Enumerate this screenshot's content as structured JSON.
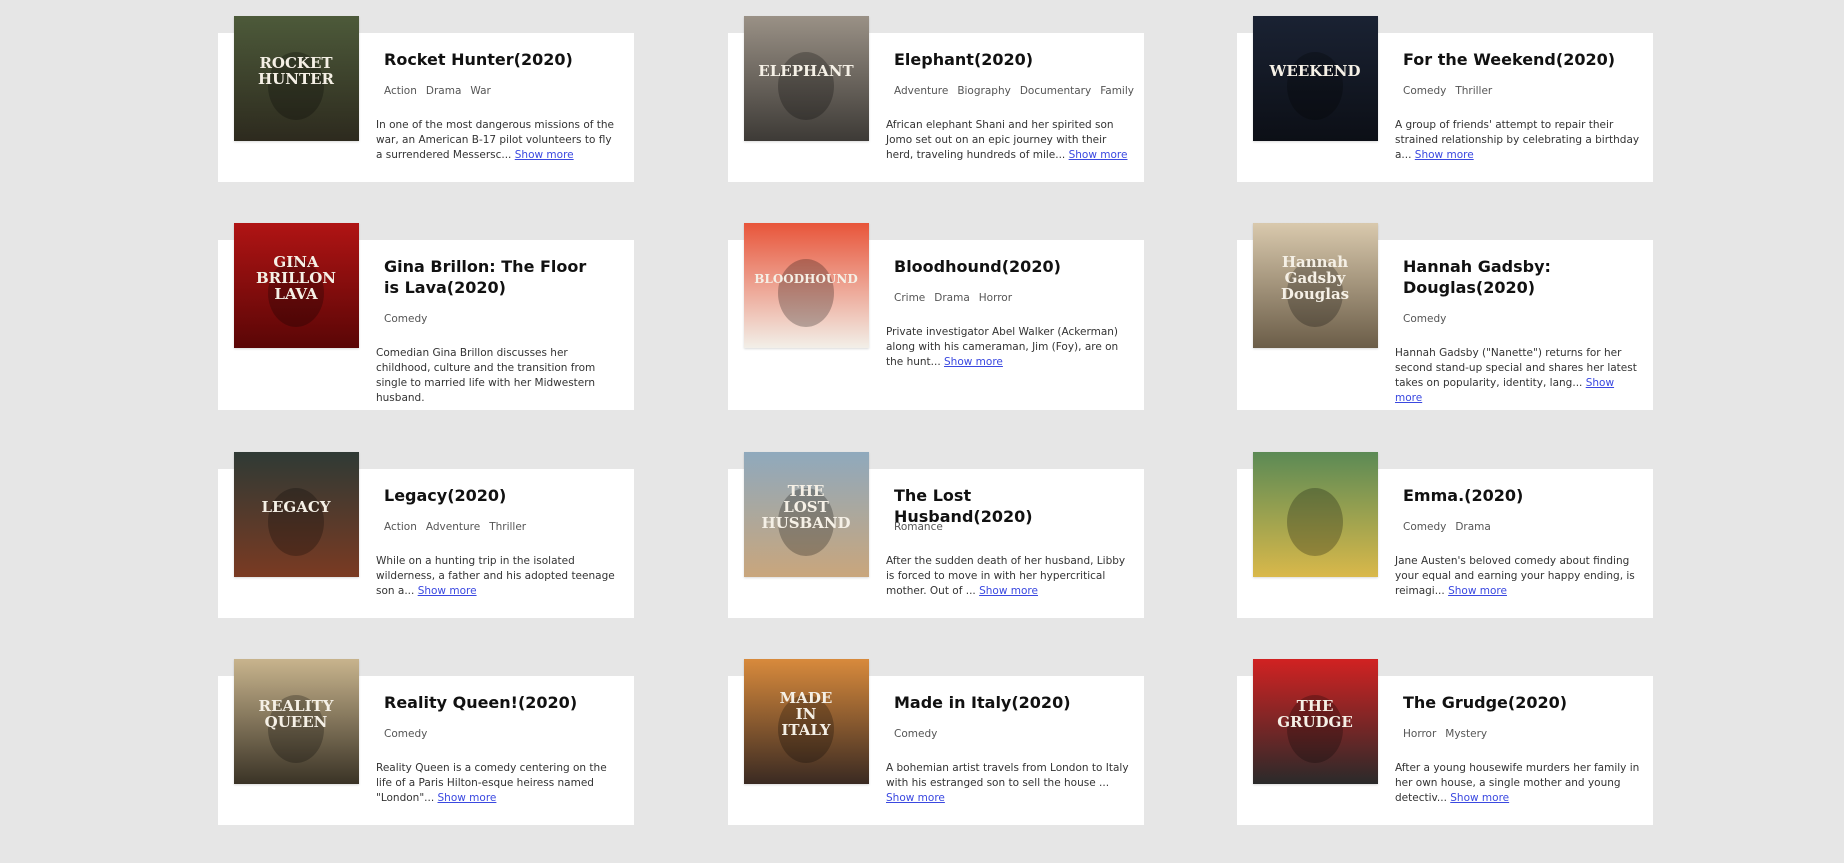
{
  "movies": [
    {
      "title": "Rocket Hunter(2020)",
      "genres": [
        "Action",
        "Drama",
        "War"
      ],
      "desc": "In one of the most dangerous missions of the war, an American B-17 pilot volunteers to fly a surrendered Messersc...",
      "more": "Show more",
      "poster_text": "ROCKET HUNTER",
      "colors": [
        "#4d5a3a",
        "#2d2a1e"
      ]
    },
    {
      "title": "Elephant(2020)",
      "genres": [
        "Adventure",
        "Biography",
        "Documentary",
        "Family"
      ],
      "desc": "African elephant Shani and her spirited son Jomo set out on an epic journey with their herd, traveling hundreds of mile...",
      "more": "Show more",
      "poster_text": "ELEPHANT",
      "colors": [
        "#9a9186",
        "#3d3a36"
      ]
    },
    {
      "title": "For the Weekend(2020)",
      "genres": [
        "Comedy",
        "Thriller"
      ],
      "desc": "A group of friends' attempt to repair their strained relationship by celebrating a birthday a...",
      "more": "Show more",
      "poster_text": "WEEKEND",
      "colors": [
        "#1a2233",
        "#0c0f16"
      ]
    },
    {
      "title": "Gina Brillon: The Floor is Lava(2020)",
      "genres": [
        "Comedy"
      ],
      "desc": "Comedian Gina Brillon discusses her childhood, culture and the transition from single to married life with her Midwestern husband.",
      "more": "",
      "poster_text": "GINA BRILLON LAVA",
      "colors": [
        "#b01414",
        "#5a0606"
      ]
    },
    {
      "title": "Bloodhound(2020)",
      "genres": [
        "Crime",
        "Drama",
        "Horror"
      ],
      "desc": "Private investigator Abel Walker (Ackerman) along with his cameraman, Jim (Foy), are on the hunt...",
      "more": "Show more",
      "poster_text": "BLOODHOUND",
      "colors": [
        "#e8553a",
        "#f2efe8"
      ]
    },
    {
      "title": "Hannah Gadsby: Douglas(2020)",
      "genres": [
        "Comedy"
      ],
      "desc": "Hannah Gadsby (\"Nanette\") returns for her second stand-up special and shares her latest takes on popularity, identity, lang...",
      "more": "Show more",
      "poster_text": "Hannah Gadsby Douglas",
      "colors": [
        "#d9c9ad",
        "#6b5d48"
      ]
    },
    {
      "title": "Legacy(2020)",
      "genres": [
        "Action",
        "Adventure",
        "Thriller"
      ],
      "desc": "While on a hunting trip in the isolated wilderness, a father and his adopted teenage son a...",
      "more": "Show more",
      "poster_text": "LEGACY",
      "colors": [
        "#2f3a35",
        "#7a3a22"
      ]
    },
    {
      "title": "The Lost Husband(2020)",
      "genres": [
        "Romance"
      ],
      "desc": "After the sudden death of her husband, Libby is forced to move in with her hypercritical mother. Out of ...",
      "more": "Show more",
      "poster_text": "THE LOST HUSBAND",
      "colors": [
        "#8fa9bd",
        "#c9a67c"
      ]
    },
    {
      "title": "Emma.(2020)",
      "genres": [
        "Comedy",
        "Drama"
      ],
      "desc": "Jane Austen's beloved comedy about finding your equal and earning your happy ending, is reimagi...",
      "more": "Show more",
      "poster_text": "",
      "colors": [
        "#5b8a55",
        "#d9b84a"
      ]
    },
    {
      "title": "Reality Queen!(2020)",
      "genres": [
        "Comedy"
      ],
      "desc": "Reality Queen is a comedy centering on the life of a Paris Hilton-esque heiress named \"London\"...",
      "more": "Show more",
      "poster_text": "REALITY QUEEN",
      "colors": [
        "#c8b48d",
        "#3a3326"
      ]
    },
    {
      "title": "Made in Italy(2020)",
      "genres": [
        "Comedy"
      ],
      "desc": "A bohemian artist travels from London to Italy with his estranged son to sell the house ...",
      "more": "Show more",
      "poster_text": "MADE IN ITALY",
      "colors": [
        "#d88a3c",
        "#3a2a22"
      ]
    },
    {
      "title": "The Grudge(2020)",
      "genres": [
        "Horror",
        "Mystery"
      ],
      "desc": "After a young housewife murders her family in her own house, a single mother and young detectiv...",
      "more": "Show more",
      "poster_text": "THE GRUDGE",
      "colors": [
        "#d12222",
        "#2a2a2a"
      ]
    }
  ]
}
